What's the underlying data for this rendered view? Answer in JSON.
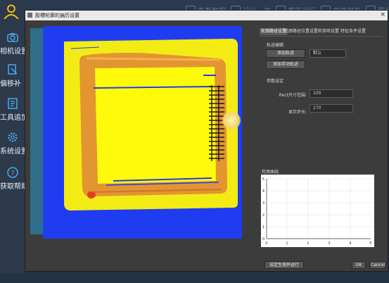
{
  "sidebar": {
    "items": [
      {
        "label": "",
        "icon": "user-outline-icon"
      },
      {
        "label": "相机设置",
        "icon": "camera-icon"
      },
      {
        "label": "偏移补",
        "icon": "offset-doc-icon"
      },
      {
        "label": "工具追加",
        "icon": "tool-list-icon"
      },
      {
        "label": "系统设置",
        "icon": "gear-icon"
      },
      {
        "label": "获取帮助",
        "icon": "help-icon"
      }
    ]
  },
  "topbar": {
    "items": [
      "查看数据",
      "设计一次",
      "重新运行",
      "文件保存",
      "图片"
    ]
  },
  "dialog": {
    "title": "胶槽轮廓的遍历设置",
    "close": "×",
    "tabs": [
      "轮廓路径设置",
      "轮廓路径位置设置",
      "检测项设置",
      "特征条件设置"
    ],
    "section_trajectory": "轨迹编辑",
    "btn_add_trajectory": "添加轨迹",
    "select_value": "默认",
    "btn_add_manual": "添加手动轨迹",
    "section_params": "参数设定",
    "param1_label": "Rect尺寸范围:",
    "param1_value": "100",
    "param2_label": "显示步长:",
    "param2_value": "270",
    "graph_title": "轮廓曲线",
    "graph_xticks": [
      "0",
      "1",
      "2",
      "3",
      "4",
      "5"
    ],
    "graph_yticks": [
      "0",
      "1",
      "2",
      "3",
      "4",
      "5"
    ],
    "btn_apply": "设定生效并运行",
    "btn_ok": "OK",
    "btn_cancel": "Cancel"
  },
  "colors": {
    "heatmap_background": "#1f3cf0",
    "heatmap_plateau": "#f3ec14",
    "heatmap_groove": "#e29531",
    "heatmap_inner": "#fffa0b",
    "dialog_background": "#3c3c3c"
  }
}
